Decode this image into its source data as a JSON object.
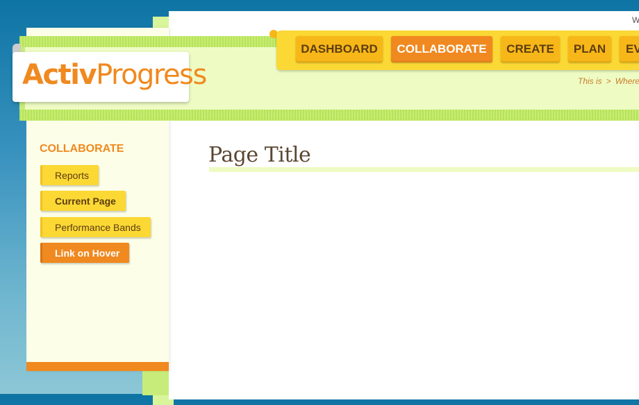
{
  "header": {
    "top_right_text": "W",
    "logo": {
      "part1": "Activ",
      "part2": "Progress"
    }
  },
  "nav": {
    "tabs": [
      {
        "label": "DASHBOARD",
        "active": false
      },
      {
        "label": "COLLABORATE",
        "active": true
      },
      {
        "label": "CREATE",
        "active": false
      },
      {
        "label": "PLAN",
        "active": false
      },
      {
        "label": "EV",
        "active": false
      }
    ]
  },
  "breadcrumb": {
    "first": "This is",
    "separator": ">",
    "second": "Where"
  },
  "sidebar": {
    "heading": "COLLABORATE",
    "items": [
      {
        "label": "Reports",
        "state": "normal"
      },
      {
        "label": "Current Page",
        "state": "current"
      },
      {
        "label": "Performance Bands",
        "state": "normal"
      },
      {
        "label": "Link on Hover",
        "state": "hover"
      }
    ]
  },
  "main": {
    "page_title": "Page Title"
  },
  "colors": {
    "accent_orange": "#f0891f",
    "nav_yellow": "#fbd834",
    "tab_yellow": "#f8b718",
    "band_green": "#b7e35a",
    "pale_green": "#eefcc4"
  }
}
